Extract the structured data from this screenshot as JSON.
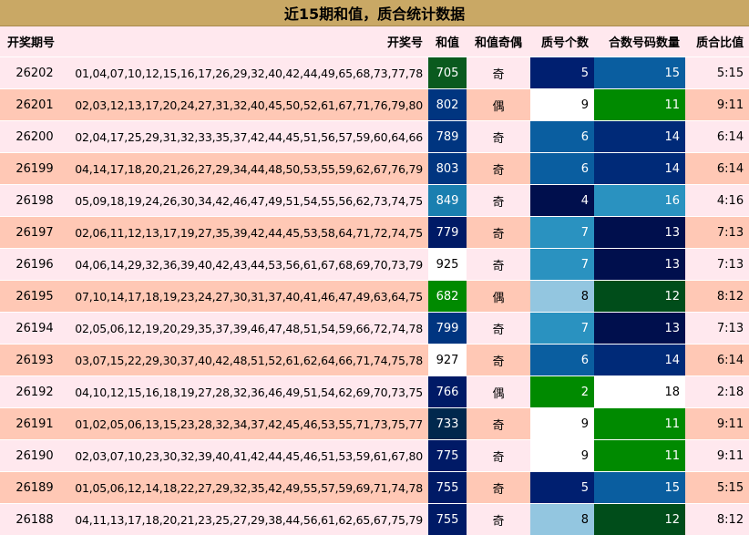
{
  "title": "近15期和值，质合统计数据",
  "headers": {
    "issue": "开奖期号",
    "numbers": "开奖号",
    "sum": "和值",
    "parity": "和值奇偶",
    "prime_count": "质号个数",
    "composite_count": "合数号码数量",
    "ratio": "质合比值"
  },
  "colors": {
    "title_bg": "#c9a865",
    "row_light": "#ffe8ee",
    "row_dark": "#ffc8b5",
    "navy": "#001a66",
    "blue": "#003580",
    "darkgreen": "#004d1a",
    "green": "#008a00",
    "teal": "#0a4d7a",
    "midblue": "#0a5ea0",
    "lightblue": "#2a92c0",
    "paleblue": "#93c6e0",
    "deepnavy": "#000f4d",
    "white": "#ffffff"
  },
  "rows": [
    {
      "issue": "26202",
      "numbers": "01,04,07,10,12,15,16,17,26,29,32,40,42,44,49,65,68,73,77,78",
      "sum": "705",
      "parity": "奇",
      "prime": "5",
      "comp": "15",
      "ratio": "5:15",
      "sum_color": "#0a5a1e",
      "prime_color": "#001f70",
      "comp_color": "#0a5ea0"
    },
    {
      "issue": "26201",
      "numbers": "02,03,12,13,17,20,24,27,31,32,40,45,50,52,61,67,71,76,79,80",
      "sum": "802",
      "parity": "偶",
      "prime": "9",
      "comp": "11",
      "ratio": "9:11",
      "sum_color": "#003580",
      "prime_color": "#ffffff",
      "comp_color": "#008a00"
    },
    {
      "issue": "26200",
      "numbers": "02,04,17,25,29,31,32,33,35,37,42,44,45,51,56,57,59,60,64,66",
      "sum": "789",
      "parity": "奇",
      "prime": "6",
      "comp": "14",
      "ratio": "6:14",
      "sum_color": "#003580",
      "prime_color": "#0a5ea0",
      "comp_color": "#002a78"
    },
    {
      "issue": "26199",
      "numbers": "04,14,17,18,20,21,26,27,29,34,44,48,50,53,55,59,62,67,76,79",
      "sum": "803",
      "parity": "奇",
      "prime": "6",
      "comp": "14",
      "ratio": "6:14",
      "sum_color": "#003580",
      "prime_color": "#0a5ea0",
      "comp_color": "#002a78"
    },
    {
      "issue": "26198",
      "numbers": "05,09,18,19,24,26,30,34,42,46,47,49,51,54,55,56,62,73,74,75",
      "sum": "849",
      "parity": "奇",
      "prime": "4",
      "comp": "16",
      "ratio": "4:16",
      "sum_color": "#1a7fb0",
      "prime_color": "#000f4d",
      "comp_color": "#2a92c0"
    },
    {
      "issue": "26197",
      "numbers": "02,06,11,12,13,17,19,27,35,39,42,44,45,53,58,64,71,72,74,75",
      "sum": "779",
      "parity": "奇",
      "prime": "7",
      "comp": "13",
      "ratio": "7:13",
      "sum_color": "#001a66",
      "prime_color": "#2a92c0",
      "comp_color": "#000f4d"
    },
    {
      "issue": "26196",
      "numbers": "04,06,14,29,32,36,39,40,42,43,44,53,56,61,67,68,69,70,73,79",
      "sum": "925",
      "parity": "奇",
      "prime": "7",
      "comp": "13",
      "ratio": "7:13",
      "sum_color": "#ffffff",
      "prime_color": "#2a92c0",
      "comp_color": "#000f4d"
    },
    {
      "issue": "26195",
      "numbers": "07,10,14,17,18,19,23,24,27,30,31,37,40,41,46,47,49,63,64,75",
      "sum": "682",
      "parity": "偶",
      "prime": "8",
      "comp": "12",
      "ratio": "8:12",
      "sum_color": "#008a00",
      "prime_color": "#93c6e0",
      "comp_color": "#004d1a"
    },
    {
      "issue": "26194",
      "numbers": "02,05,06,12,19,20,29,35,37,39,46,47,48,51,54,59,66,72,74,78",
      "sum": "799",
      "parity": "奇",
      "prime": "7",
      "comp": "13",
      "ratio": "7:13",
      "sum_color": "#003580",
      "prime_color": "#2a92c0",
      "comp_color": "#000f4d"
    },
    {
      "issue": "26193",
      "numbers": "03,07,15,22,29,30,37,40,42,48,51,52,61,62,64,66,71,74,75,78",
      "sum": "927",
      "parity": "奇",
      "prime": "6",
      "comp": "14",
      "ratio": "6:14",
      "sum_color": "#ffffff",
      "prime_color": "#0a5ea0",
      "comp_color": "#002a78"
    },
    {
      "issue": "26192",
      "numbers": "04,10,12,15,16,18,19,27,28,32,36,46,49,51,54,62,69,70,73,75",
      "sum": "766",
      "parity": "偶",
      "prime": "2",
      "comp": "18",
      "ratio": "2:18",
      "sum_color": "#001a66",
      "prime_color": "#008a00",
      "comp_color": "#ffffff"
    },
    {
      "issue": "26191",
      "numbers": "01,02,05,06,13,15,23,28,32,34,37,42,45,46,53,55,71,73,75,77",
      "sum": "733",
      "parity": "奇",
      "prime": "9",
      "comp": "11",
      "ratio": "9:11",
      "sum_color": "#00284d",
      "prime_color": "#ffffff",
      "comp_color": "#008a00"
    },
    {
      "issue": "26190",
      "numbers": "02,03,07,10,23,30,32,39,40,41,42,44,45,46,51,53,59,61,67,80",
      "sum": "775",
      "parity": "奇",
      "prime": "9",
      "comp": "11",
      "ratio": "9:11",
      "sum_color": "#001a66",
      "prime_color": "#ffffff",
      "comp_color": "#008a00"
    },
    {
      "issue": "26189",
      "numbers": "01,05,06,12,14,18,22,27,29,32,35,42,49,55,57,59,69,71,74,78",
      "sum": "755",
      "parity": "奇",
      "prime": "5",
      "comp": "15",
      "ratio": "5:15",
      "sum_color": "#001a66",
      "prime_color": "#001f70",
      "comp_color": "#0a5ea0"
    },
    {
      "issue": "26188",
      "numbers": "04,11,13,17,18,20,21,23,25,27,29,38,44,56,61,62,65,67,75,79",
      "sum": "755",
      "parity": "奇",
      "prime": "8",
      "comp": "12",
      "ratio": "8:12",
      "sum_color": "#001a66",
      "prime_color": "#93c6e0",
      "comp_color": "#004d1a"
    }
  ]
}
